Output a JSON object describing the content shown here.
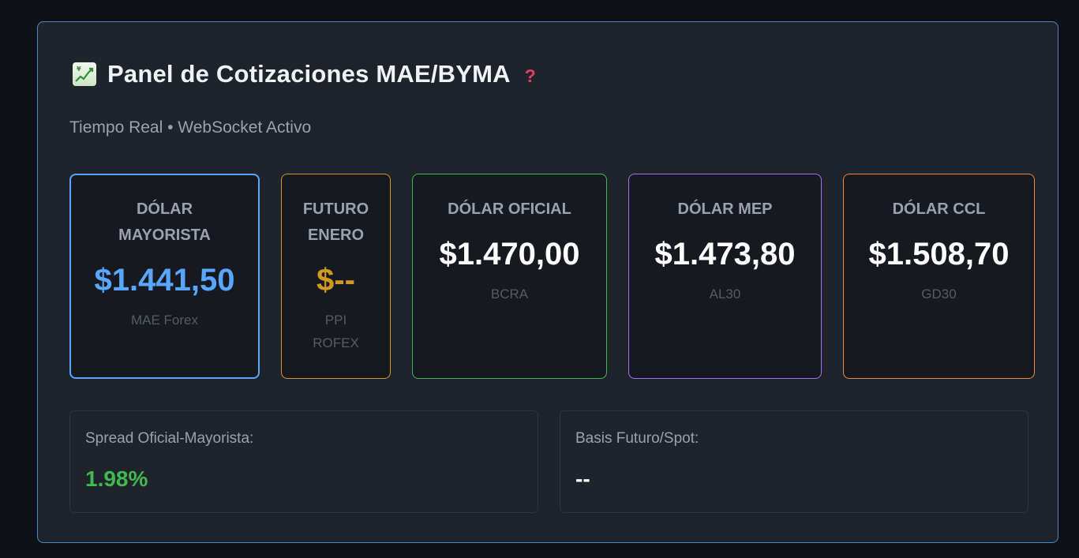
{
  "header": {
    "title": "Panel de Cotizaciones MAE/BYMA",
    "icon": "chart-increasing-yen-icon",
    "help_icon": "question-mark-icon",
    "help_symbol": "?"
  },
  "subtitle": "Tiempo Real • WebSocket Activo",
  "cards": [
    {
      "label_line1": "DÓLAR",
      "label_line2": "MAYORISTA",
      "value": "$1.441,50",
      "source_line1": "MAE Forex",
      "source_line2": "",
      "accent": "#58a6ff"
    },
    {
      "label_line1": "FUTURO",
      "label_line2": "ENERO",
      "value": "$--",
      "source_line1": "PPI",
      "source_line2": "ROFEX",
      "accent": "#d29922"
    },
    {
      "label_line1": "DÓLAR OFICIAL",
      "label_line2": "",
      "value": "$1.470,00",
      "source_line1": "BCRA",
      "source_line2": "",
      "accent": "#3fb950"
    },
    {
      "label_line1": "DÓLAR MEP",
      "label_line2": "",
      "value": "$1.473,80",
      "source_line1": "AL30",
      "source_line2": "",
      "accent": "#a371f7"
    },
    {
      "label_line1": "DÓLAR CCL",
      "label_line2": "",
      "value": "$1.508,70",
      "source_line1": "GD30",
      "source_line2": "",
      "accent": "#f0883e"
    }
  ],
  "metrics": [
    {
      "label": "Spread Oficial-Mayorista:",
      "value": "1.98%",
      "color": "#3fb950"
    },
    {
      "label": "Basis Futuro/Spot:",
      "value": "--",
      "color": "#ffffff"
    }
  ]
}
